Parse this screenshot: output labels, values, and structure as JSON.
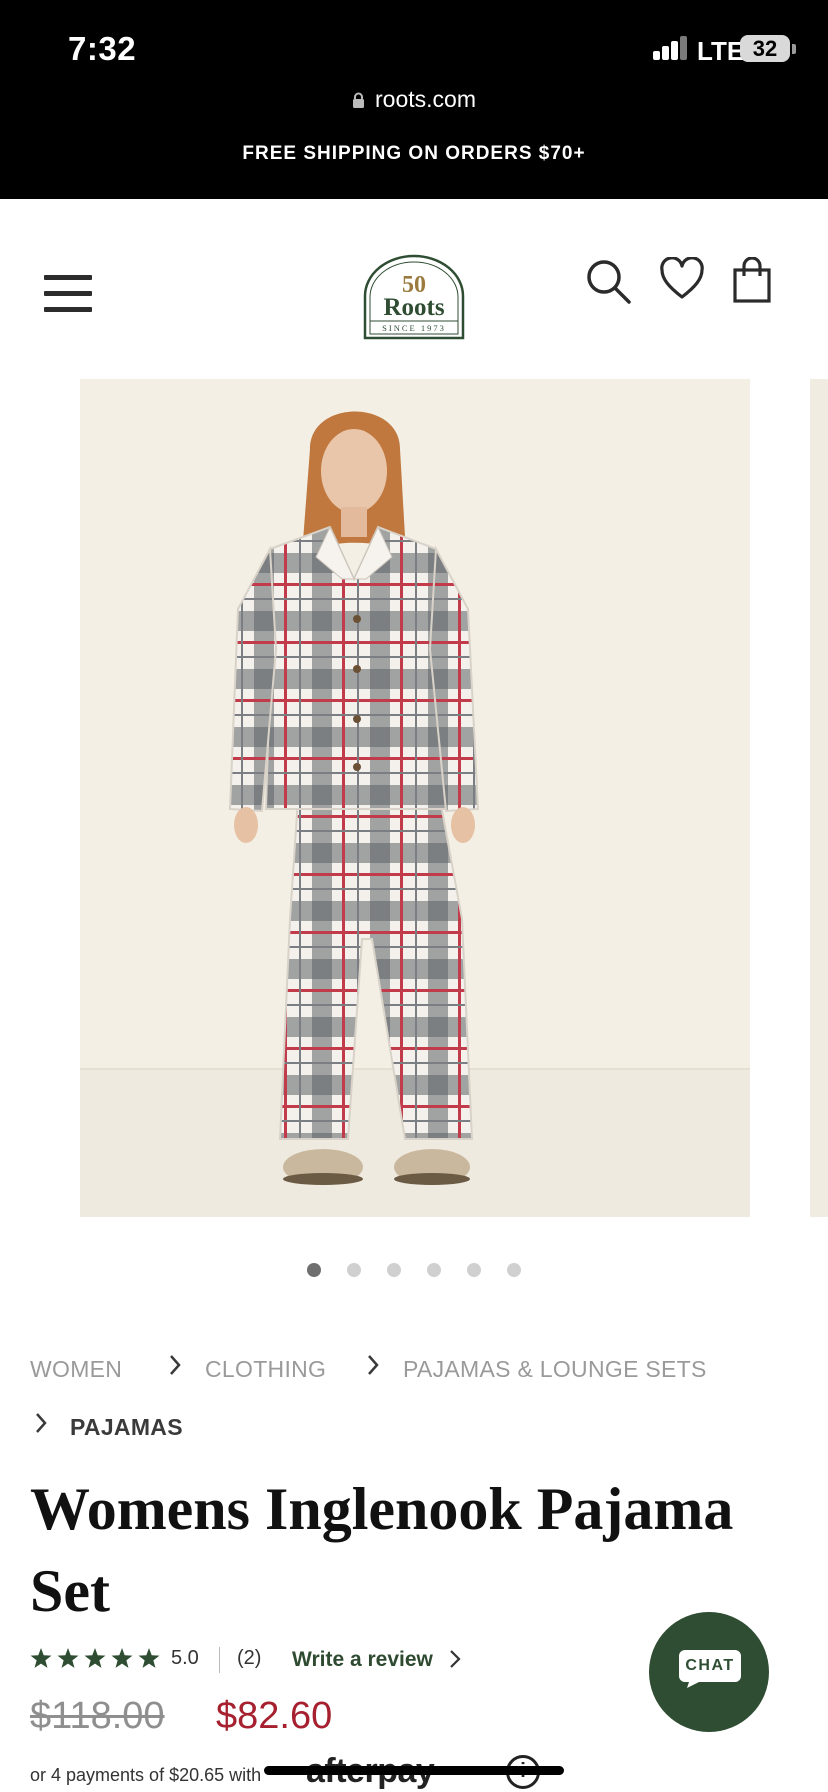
{
  "status_bar": {
    "time": "7:32",
    "network": "LTE",
    "battery": "32"
  },
  "browser": {
    "url": "roots.com"
  },
  "promo_banner": {
    "text": "FREE SHIPPING ON ORDERS $70+"
  },
  "header": {
    "logo": {
      "number": "50",
      "brand": "Roots",
      "tagline": "SINCE 1973"
    }
  },
  "gallery": {
    "dot_count": 6,
    "active_index": 0
  },
  "breadcrumbs": [
    {
      "label": "WOMEN"
    },
    {
      "label": "CLOTHING"
    },
    {
      "label": "PAJAMAS & LOUNGE SETS"
    },
    {
      "label": "PAJAMAS"
    }
  ],
  "product": {
    "title": "Womens Inglenook Pajama Set",
    "rating": {
      "stars": 5,
      "value": "5.0",
      "count": "(2)",
      "write_review_label": "Write a review"
    },
    "price": {
      "original": "$118.00",
      "sale": "$82.60"
    },
    "installments": {
      "text": "or 4 payments of $20.65 with",
      "provider": "afterpay",
      "info_icon": "ⓘ"
    }
  },
  "chat": {
    "label": "CHAT"
  },
  "colors": {
    "brand_green": "#2f4d32",
    "sale_red": "#a6202f",
    "banner_black": "#000000"
  }
}
